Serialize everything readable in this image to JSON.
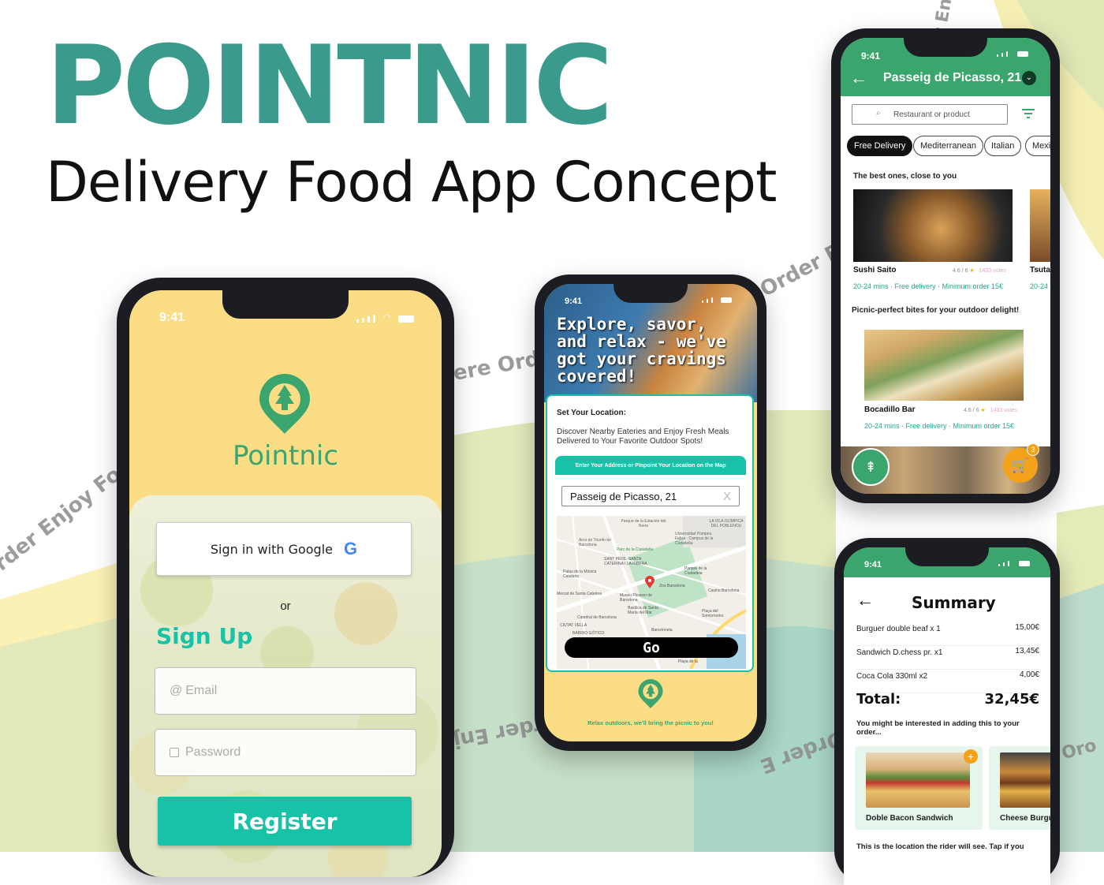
{
  "header": {
    "brand": "POINTNIC",
    "tagline": "Delivery Food App Concept"
  },
  "ribbons": [
    "Order Enjoy Food",
    "ere Orde",
    "Order Enj",
    "Order Enj",
    "Order E",
    "r Eni",
    "Oro"
  ],
  "colors": {
    "brand_teal": "#3a9b8c",
    "app_green": "#3aa66e",
    "yellow": "#fbdd86",
    "button_teal": "#18c2a7"
  },
  "status_time": "9:41",
  "login": {
    "app_name": "Pointnic",
    "google_button": "Sign in with Google",
    "or_label": "or",
    "signup_title": "Sign Up",
    "email_placeholder": "Email",
    "password_placeholder": "Password",
    "register_button": "Register"
  },
  "location": {
    "hero_text": "Explore, savor, and relax - we've got your cravings covered!",
    "set_location_title": "Set Your Location:",
    "description": "Discover Nearby Eateries and Enjoy Fresh Meals Delivered to Your Favorite Outdoor Spots!",
    "address_banner": "Enter Your Address or Pinpoint Your Location on the Map",
    "address_value": "Passeig de Picasso, 21",
    "clear_label": "X",
    "map_labels": [
      "Parque de la Estación del Norte",
      "Arco de Triunfo de Barcelona",
      "Parc de la Ciutadella",
      "SANT PERE, SANTA CATERINA I LA RIBERA",
      "Palau de la Música Catalana",
      "Universidad Pompeu Fabra - Campus de la Ciutadella",
      "LA VILA OLÍMPICA DEL POBLENOU",
      "Zoo Barcelona",
      "Museu Picasso de Barcelona",
      "Basílica de Santa María del Mar",
      "Catedral de Barcelona",
      "Mercat de Santa Caterina",
      "Parque de la Ciudadela",
      "Casino Barcelona",
      "Plaça del Somorrostro",
      "Barceloneta",
      "CIUTAT VELLA",
      "BARRIO GÓTICO",
      "Playa de la"
    ],
    "go_button": "Go",
    "footer_text": "Relax outdoors, we'll bring the picnic to you!"
  },
  "home": {
    "address": "Passeig de Picasso, 21",
    "search_placeholder": "Restaurant or product",
    "filters": [
      "Free Delivery",
      "Mediterranean",
      "Italian",
      "Mexic"
    ],
    "section1_title": "The best ones, close to you",
    "restaurants1": [
      {
        "name": "Sushi Saito",
        "rating": "4.6 / 6",
        "votes": "1433 votes",
        "info": "20-24 mins · Free delivery · Minimum order 15€"
      },
      {
        "name": "Tsuta",
        "info": "20-24"
      }
    ],
    "section2_title": "Picnic-perfect bites for your outdoor delight!",
    "restaurants2": [
      {
        "name": "Bocadillo Bar",
        "rating": "4.6 / 6",
        "votes": "1433 votes",
        "info": "20-24 mins · Free delivery · Minimum order 15€"
      }
    ],
    "cart_count": "3"
  },
  "summary": {
    "title": "Summary",
    "items": [
      {
        "name": "Burguer double beaf x 1",
        "price": "15,00€"
      },
      {
        "name": "Sandwich D.chess pr. x1",
        "price": "13,45€"
      },
      {
        "name": "Coca Cola 330ml x2",
        "price": "4,00€"
      }
    ],
    "total_label": "Total:",
    "total_value": "32,45€",
    "suggest_text": "You might be interested in adding this to your order...",
    "suggestions": [
      {
        "name": "Doble Bacon Sandwich"
      },
      {
        "name": "Cheese Burgu"
      }
    ],
    "footer_text": "This is the location the rider will see. Tap if you"
  }
}
